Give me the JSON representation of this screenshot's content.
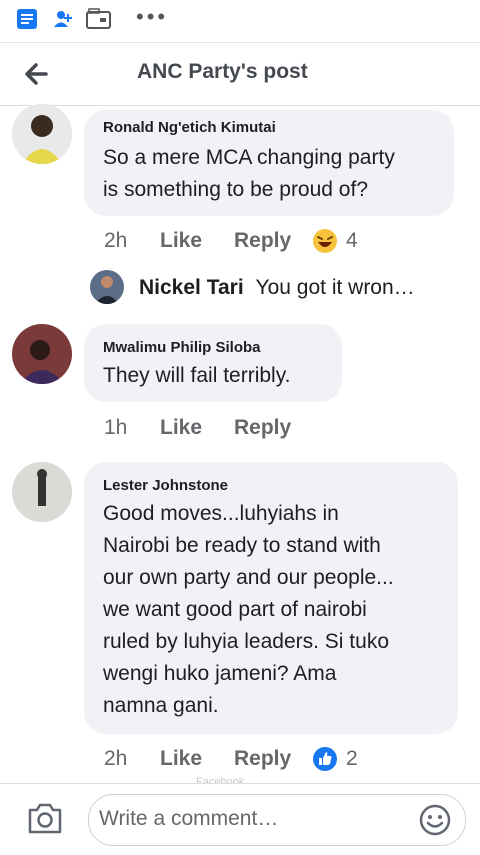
{
  "header": {
    "title": "ANC Party's post"
  },
  "statusbar": {
    "more_icon": "more-dots-icon"
  },
  "comments": [
    {
      "author": "Ronald Ng'etich Kimutai",
      "lines": [
        "So a mere MCA changing party",
        "is something to be proud of?"
      ],
      "time": "2h",
      "like": "Like",
      "reply": "Reply",
      "reaction": "haha-emoji",
      "reaction_count": "4"
    },
    {
      "author": "Mwalimu Philip Siloba",
      "lines": [
        "They will fail terribly."
      ],
      "time": "1h",
      "like": "Like",
      "reply": "Reply"
    },
    {
      "author": "Lester Johnstone",
      "lines": [
        "Good moves...luhyiahs in",
        "Nairobi be ready to stand with",
        "our own party and our  people...",
        "we want good part of nairobi",
        "ruled by luhyia leaders. Si tuko",
        "wengi huko jameni? Ama",
        "namna gani."
      ],
      "time": "2h",
      "like": "Like",
      "reply": "Reply",
      "reaction": "like-thumb",
      "reaction_count": "2"
    }
  ],
  "reply_preview": {
    "author": "Nickel Tari",
    "text": "You got it wron…"
  },
  "composer": {
    "placeholder": "Write a comment…"
  },
  "watermark": "Facebook",
  "colors": {
    "accent": "#1877f2",
    "bubble": "#f0f2f5",
    "meta": "#65676b"
  }
}
